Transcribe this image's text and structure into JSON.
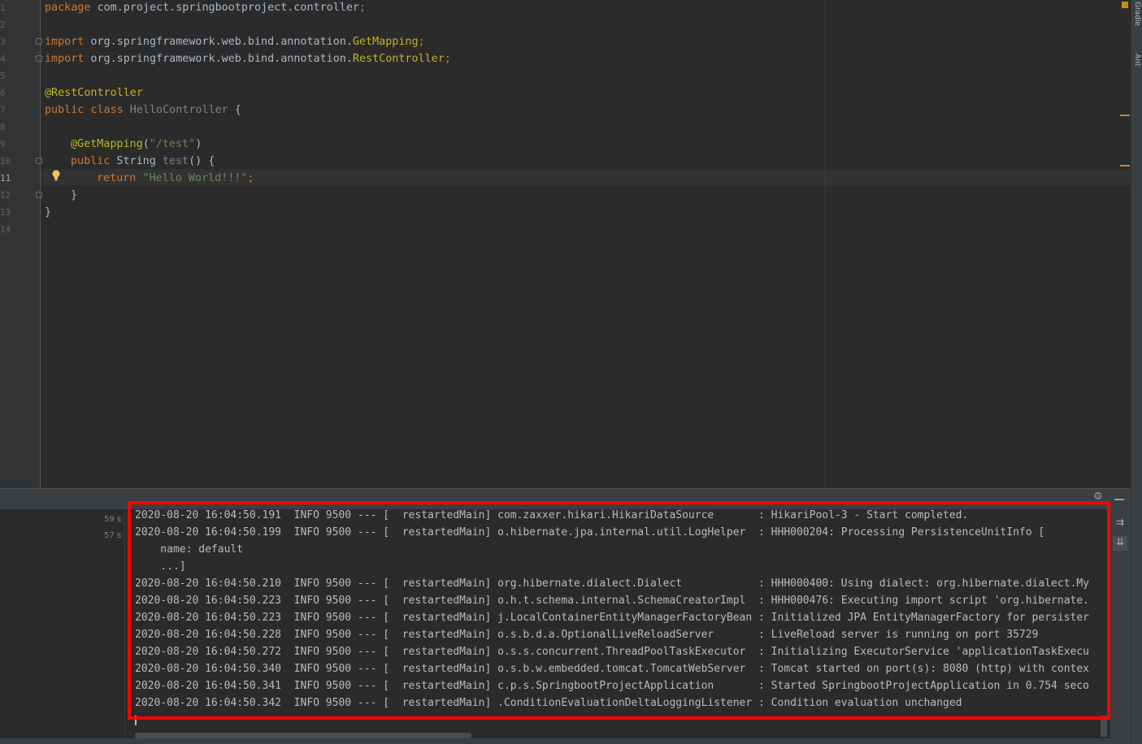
{
  "editor": {
    "line_numbers": [
      "1",
      "2",
      "3",
      "4",
      "5",
      "6",
      "7",
      "8",
      "9",
      "10",
      "11",
      "12",
      "13",
      "14"
    ],
    "active_line": "11",
    "lines": {
      "l1_kw": "package",
      "l1_rest": " com.project.springbootproject.controller",
      "l1_semi": ";",
      "l3_kw": "import",
      "l3_rest": " org.springframework.web.bind.annotation.",
      "l3_cls": "GetMapping",
      "l3_semi": ";",
      "l4_kw": "import",
      "l4_rest": " org.springframework.web.bind.annotation.",
      "l4_cls": "RestController",
      "l4_semi": ";",
      "l6_ann": "@RestController",
      "l7_kw": "public class",
      "l7_name": " HelloController",
      "l7_brace": " {",
      "l9_ann": "@GetMapping",
      "l9_open": "(",
      "l9_str": "\"/test\"",
      "l9_close": ")",
      "l10_kw": "public",
      "l10_type": " String",
      "l10_fn": " test",
      "l10_rest": "() {",
      "l11_kw": "return",
      "l11_str": " \"Hello World!!!\"",
      "l11_semi": ";",
      "l12": "}",
      "l13": "}"
    }
  },
  "side_tabs": {
    "gradle": "Gradle",
    "ant": "Ant"
  },
  "console": {
    "time_labels": [
      "59 s",
      "57 s"
    ],
    "logs": [
      "2020-08-20 16:04:50.191  INFO 9500 --- [  restartedMain] com.zaxxer.hikari.HikariDataSource       : HikariPool-3 - Start completed.",
      "2020-08-20 16:04:50.199  INFO 9500 --- [  restartedMain] o.hibernate.jpa.internal.util.LogHelper  : HHH000204: Processing PersistenceUnitInfo [",
      "    name: default",
      "    ...]",
      "2020-08-20 16:04:50.210  INFO 9500 --- [  restartedMain] org.hibernate.dialect.Dialect            : HHH000400: Using dialect: org.hibernate.dialect.My",
      "2020-08-20 16:04:50.223  INFO 9500 --- [  restartedMain] o.h.t.schema.internal.SchemaCreatorImpl  : HHH000476: Executing import script 'org.hibernate.",
      "2020-08-20 16:04:50.223  INFO 9500 --- [  restartedMain] j.LocalContainerEntityManagerFactoryBean : Initialized JPA EntityManagerFactory for persister",
      "2020-08-20 16:04:50.228  INFO 9500 --- [  restartedMain] o.s.b.d.a.OptionalLiveReloadServer       : LiveReload server is running on port 35729",
      "2020-08-20 16:04:50.272  INFO 9500 --- [  restartedMain] o.s.s.concurrent.ThreadPoolTaskExecutor  : Initializing ExecutorService 'applicationTaskExecu",
      "2020-08-20 16:04:50.340  INFO 9500 --- [  restartedMain] o.s.b.w.embedded.tomcat.TomcatWebServer  : Tomcat started on port(s): 8080 (http) with contex",
      "2020-08-20 16:04:50.341  INFO 9500 --- [  restartedMain] c.p.s.SpringbootProjectApplication       : Started SpringbootProjectApplication in 0.754 seco",
      "2020-08-20 16:04:50.342  INFO 9500 --- [  restartedMain] .ConditionEvaluationDeltaLoggingListener : Condition evaluation unchanged"
    ]
  },
  "icons": {
    "gear": "⚙",
    "wrap": "⇉",
    "scroll_end": "⇊"
  },
  "colors": {
    "highlight_box": "#ff0000",
    "keyword": "#cc7832",
    "annotation": "#bbb529",
    "string": "#6a8759"
  }
}
